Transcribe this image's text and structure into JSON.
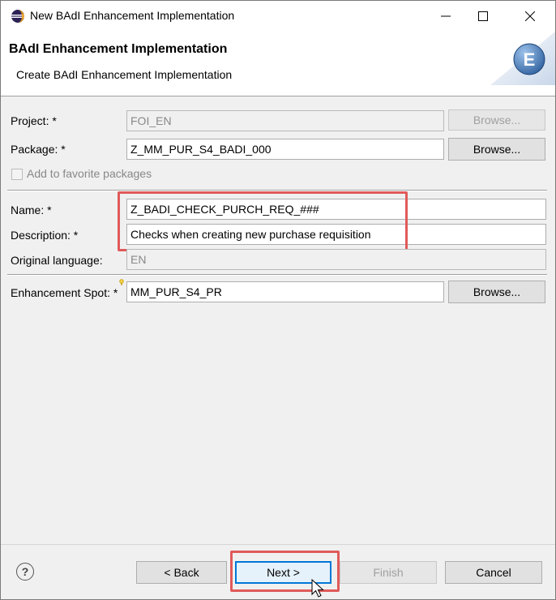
{
  "window": {
    "title": "New BAdI Enhancement Implementation"
  },
  "header": {
    "title": "BAdI Enhancement Implementation",
    "subtitle": "Create BAdI Enhancement Implementation",
    "wizard_icon_letter": "E"
  },
  "form": {
    "project_label": "Project: *",
    "project_value": "FOI_EN",
    "package_label": "Package: *",
    "package_value": "Z_MM_PUR_S4_BADI_000",
    "favorite_label": "Add to favorite packages",
    "name_label": "Name: *",
    "name_value": "Z_BADI_CHECK_PURCH_REQ_###",
    "description_label": "Description: *",
    "description_value": "Checks when creating new purchase requisition",
    "language_label": "Original language:",
    "language_value": "EN",
    "spot_label": "Enhancement Spot: *",
    "spot_value": "MM_PUR_S4_PR",
    "browse_label": "Browse..."
  },
  "footer": {
    "help_glyph": "?",
    "back_label": "< Back",
    "next_label": "Next >",
    "finish_label": "Finish",
    "cancel_label": "Cancel"
  },
  "colors": {
    "highlight": "#e05a5a",
    "focus": "#0078d7"
  }
}
